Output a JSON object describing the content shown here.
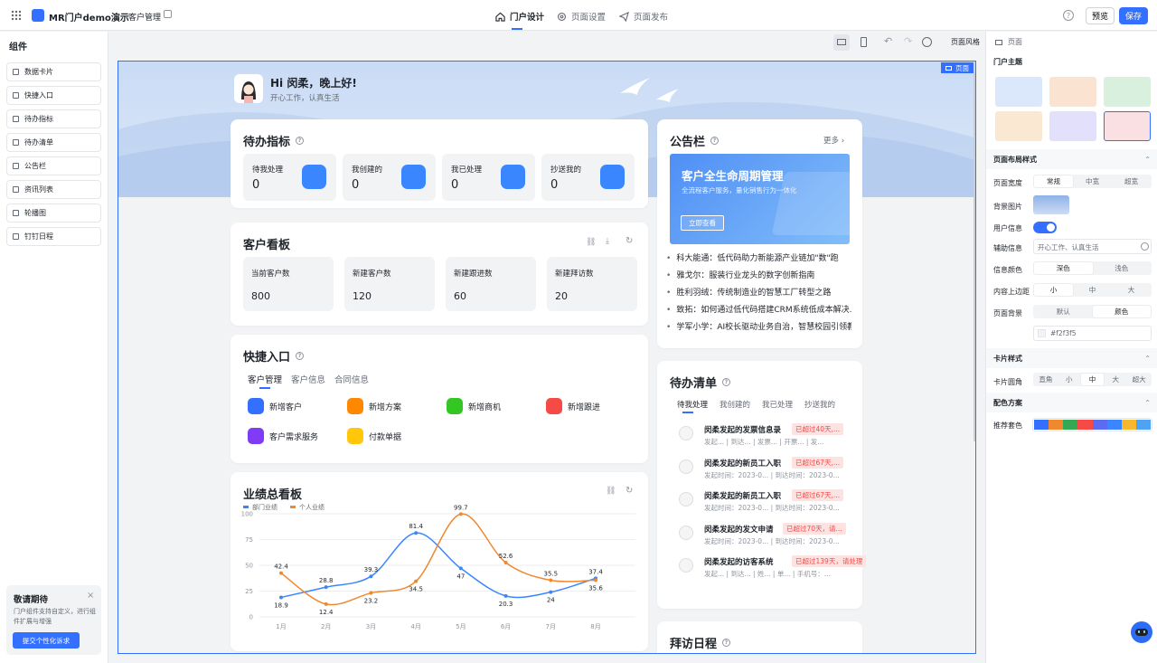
{
  "header": {
    "app_name": "MR门户demo演示",
    "breadcrumb": "客户管理",
    "tabs": [
      {
        "label": "门户设计",
        "active": true
      },
      {
        "label": "页面设置"
      },
      {
        "label": "页面发布"
      }
    ],
    "preview_label": "预览",
    "save_label": "保存"
  },
  "left_panel": {
    "title": "组件",
    "items": [
      {
        "label": "数据卡片"
      },
      {
        "label": "快捷入口"
      },
      {
        "label": "待办指标"
      },
      {
        "label": "待办清单"
      },
      {
        "label": "公告栏"
      },
      {
        "label": "资讯列表"
      },
      {
        "label": "轮播图"
      },
      {
        "label": "钉钉日程"
      }
    ],
    "promo": {
      "title": "敬请期待",
      "desc": "门户组件支持自定义，进行组件扩展与增强",
      "button": "提交个性化诉求"
    }
  },
  "canvas_bar": {
    "style_label": "页面风格"
  },
  "canvas": {
    "page_tag": "页面",
    "greeting": "Hi 闵柔，晚上好!",
    "subtitle": "开心工作，认真生活",
    "todo_metrics": {
      "title": "待办指标",
      "items": [
        {
          "label": "待我处理",
          "value": "0"
        },
        {
          "label": "我创建的",
          "value": "0"
        },
        {
          "label": "我已处理",
          "value": "0"
        },
        {
          "label": "抄送我的",
          "value": "0"
        }
      ]
    },
    "customer_board": {
      "title": "客户看板",
      "items": [
        {
          "label": "当前客户数",
          "value": "800"
        },
        {
          "label": "新建客户数",
          "value": "120"
        },
        {
          "label": "新建跟进数",
          "value": "60"
        },
        {
          "label": "新建拜访数",
          "value": "20"
        }
      ]
    },
    "quick_entry": {
      "title": "快捷入口",
      "tabs": [
        "客户管理",
        "客户信息",
        "合同信息"
      ],
      "items": [
        {
          "label": "新增客户",
          "color": "#3370ff"
        },
        {
          "label": "新增方案",
          "color": "#ff8800"
        },
        {
          "label": "新增商机",
          "color": "#34c724"
        },
        {
          "label": "新增跟进",
          "color": "#f54a45"
        },
        {
          "label": "客户需求服务",
          "color": "#7f3bf5"
        },
        {
          "label": "付款单据",
          "color": "#ffc60a"
        }
      ]
    },
    "notice": {
      "title": "公告栏",
      "more": "更多",
      "banner_title": "客户全生命周期管理",
      "banner_sub": "全流程客户服务，量化销售行为一体化",
      "banner_button": "立即查看",
      "items": [
        "科大能通：低代码助力新能源产业链加\"数\"跑",
        "雅戈尔：服装行业龙头的数字创新指南",
        "胜利羽绒：传统制造业的智慧工厂转型之路",
        "致拓：如何通过低代码搭建CRM系统低成本解决...",
        "学军小学：AI校长驱动业务自治，智慧校园引领教..."
      ]
    },
    "todo_list": {
      "title": "待办清单",
      "tabs": [
        "待我处理",
        "我创建的",
        "我已处理",
        "抄送我的"
      ],
      "items": [
        {
          "title": "闵柔发起的发票信息录",
          "tag": "已超过40天,...",
          "sub": "发起...    | 到达...    | 发票...  | 开票...  | 发..."
        },
        {
          "title": "闵柔发起的新员工入职",
          "tag": "已超过67天,...",
          "sub": "发起时间：2023-0...  | 到达时间：2023-0..."
        },
        {
          "title": "闵柔发起的新员工入职",
          "tag": "已超过67天,...",
          "sub": "发起时间：2023-0...  | 到达时间：2023-0..."
        },
        {
          "title": "闵柔发起的发文申请",
          "tag": "已超过70天，请...",
          "sub": "发起时间：2023-0...  | 到达时间：2023-0..."
        },
        {
          "title": "闵柔发起的访客系统",
          "tag": "已超过139天，请处理",
          "sub": "发起...    | 到达...    | 姓...  | 单...  | 手机号：..."
        }
      ]
    },
    "visit": {
      "title": "拜访日程"
    },
    "performance": {
      "title": "业绩总看板"
    }
  },
  "chart_data": {
    "type": "line",
    "title": "业绩总看板",
    "categories": [
      "1月",
      "2月",
      "3月",
      "4月",
      "5月",
      "6月",
      "7月",
      "8月"
    ],
    "series": [
      {
        "name": "部门业绩",
        "color": "#3a86ff",
        "values": [
          18.9,
          28.8,
          39.3,
          81.4,
          47,
          20.3,
          24,
          37.4
        ]
      },
      {
        "name": "个人业绩",
        "color": "#f0882e",
        "values": [
          42.4,
          12.4,
          23.2,
          34.5,
          99.7,
          52.6,
          35.5,
          35.6
        ]
      }
    ],
    "yticks": [
      "0",
      "25",
      "50",
      "75",
      "100"
    ],
    "ylim": [
      0,
      100
    ],
    "legend": "top-left"
  },
  "right_panel": {
    "page_label": "页面",
    "theme_title": "门户主题",
    "layout_title": "页面布局样式",
    "width_label": "页面宽度",
    "width_opts": [
      "常规",
      "中宽",
      "超宽"
    ],
    "bg_image_label": "背景图片",
    "user_info_label": "用户信息",
    "aux_info_label": "辅助信息",
    "aux_info_value": "开心工作、认真生活",
    "info_color_label": "信息颜色",
    "info_color_opts": [
      "深色",
      "浅色"
    ],
    "margin_label": "内容上边距",
    "margin_opts": [
      "小",
      "中",
      "大"
    ],
    "page_bg_label": "页面背景",
    "page_bg_opts": [
      "默认",
      "颜色"
    ],
    "bg_color_value": "#f2f3f5",
    "card_style_title": "卡片样式",
    "card_radius_label": "卡片圆角",
    "radius_opts": [
      "直角",
      "小",
      "中",
      "大",
      "超大"
    ],
    "color_title": "配色方案",
    "recommend_label": "推荐套色",
    "palette": [
      "#3370ff",
      "#f0882e",
      "#34a853",
      "#f54a45",
      "#5b6cf0",
      "#3a86ff",
      "#f5b82e",
      "#4ea3f5"
    ]
  }
}
